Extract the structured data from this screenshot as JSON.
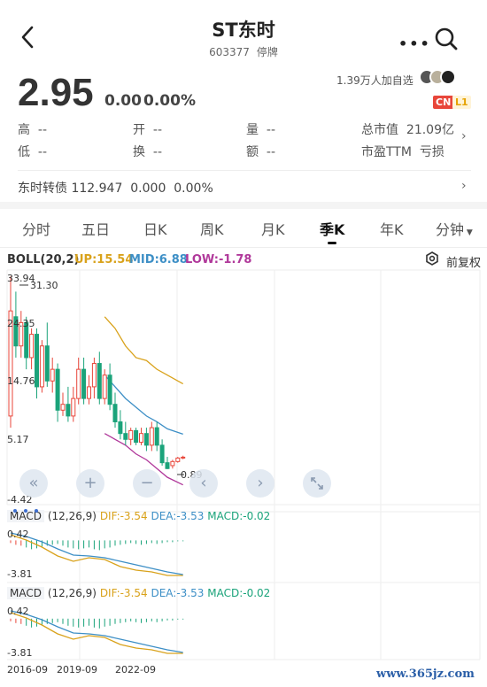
{
  "header": {
    "title": "ST东时",
    "code": "603377",
    "status": "停牌",
    "more_icon": "more-dots-icon",
    "search_icon": "search-icon",
    "back_icon": "back-arrow-icon"
  },
  "quote": {
    "price": "2.95",
    "change": "0.00",
    "change_pct": "0.00%",
    "followers": "1.39万人加自选",
    "badge_cn": "CN",
    "badge_l1": "L1"
  },
  "stats": [
    {
      "label": "高",
      "value": "--"
    },
    {
      "label": "开",
      "value": "--"
    },
    {
      "label": "量",
      "value": "--"
    },
    {
      "label": "总市值",
      "value": "21.09亿"
    },
    {
      "label": "低",
      "value": "--"
    },
    {
      "label": "换",
      "value": "--"
    },
    {
      "label": "额",
      "value": "--"
    },
    {
      "label": "市盈TTM",
      "value": "亏损"
    }
  ],
  "bond": {
    "name": "东时转债",
    "price": "112.947",
    "change": "0.000",
    "pct": "0.00%"
  },
  "tabs": [
    "分时",
    "五日",
    "日K",
    "周K",
    "月K",
    "季K",
    "年K",
    "分钟"
  ],
  "active_tab": "季K",
  "indicators": {
    "boll_name": "BOLL(20,2)",
    "up": "UP:15.54",
    "mid": "MID:6.88",
    "low": "LOW:-1.78",
    "restore_label": "前复权",
    "macd1": {
      "name": "MACD",
      "params": "(12,26,9)",
      "dif": "DIF:-3.54",
      "dea": "DEA:-3.53",
      "macd": "MACD:-0.02",
      "top": "0.42",
      "bottom": "-3.81"
    },
    "macd2": {
      "name": "MACD",
      "params": "(12,26,9)",
      "dif": "DIF:-3.54",
      "dea": "DEA:-3.53",
      "macd": "MACD:-0.02",
      "top": "0.42",
      "bottom": "-3.81"
    }
  },
  "colors": {
    "up": "#e8463a",
    "down": "#1aa37a",
    "boll_up": "#d9a21b",
    "boll_mid": "#3d8fc6",
    "boll_low": "#b0389a",
    "dif": "#d9a21b",
    "dea": "#3d8fc6"
  },
  "chart_data": {
    "type": "candlestick",
    "y_ticks": [
      "33.94",
      "24.35",
      "14.76",
      "5.17",
      "-4.42"
    ],
    "high_marker": "31.30",
    "low_marker": "0.89",
    "x_ticks": [
      "2016-09",
      "2019-09",
      "2022-09"
    ],
    "ylim": [
      -4.42,
      33.94
    ],
    "candles": [
      {
        "o": 10,
        "c": 28,
        "h": 33.9,
        "l": 8
      },
      {
        "o": 27,
        "c": 22,
        "h": 31.3,
        "l": 20
      },
      {
        "o": 22,
        "c": 26,
        "h": 28,
        "l": 20
      },
      {
        "o": 26,
        "c": 20,
        "h": 27,
        "l": 18
      },
      {
        "o": 20,
        "c": 24,
        "h": 25,
        "l": 18
      },
      {
        "o": 24,
        "c": 15,
        "h": 25,
        "l": 13
      },
      {
        "o": 15,
        "c": 22,
        "h": 23,
        "l": 14
      },
      {
        "o": 22,
        "c": 16,
        "h": 26,
        "l": 15
      },
      {
        "o": 16,
        "c": 18,
        "h": 20,
        "l": 14
      },
      {
        "o": 18,
        "c": 11,
        "h": 19,
        "l": 9
      },
      {
        "o": 11,
        "c": 12,
        "h": 14,
        "l": 10
      },
      {
        "o": 12,
        "c": 10,
        "h": 15,
        "l": 9
      },
      {
        "o": 10,
        "c": 13,
        "h": 15,
        "l": 9
      },
      {
        "o": 13,
        "c": 18,
        "h": 20,
        "l": 12
      },
      {
        "o": 18,
        "c": 13,
        "h": 20,
        "l": 12
      },
      {
        "o": 13,
        "c": 15,
        "h": 17,
        "l": 12
      },
      {
        "o": 15,
        "c": 19,
        "h": 20,
        "l": 13
      },
      {
        "o": 19,
        "c": 13,
        "h": 21,
        "l": 12
      },
      {
        "o": 13,
        "c": 17,
        "h": 18,
        "l": 12
      },
      {
        "o": 17,
        "c": 12,
        "h": 19,
        "l": 11
      },
      {
        "o": 12,
        "c": 9,
        "h": 14,
        "l": 8
      },
      {
        "o": 9,
        "c": 7,
        "h": 11,
        "l": 6
      },
      {
        "o": 7,
        "c": 6,
        "h": 9,
        "l": 5
      },
      {
        "o": 6,
        "c": 7.5,
        "h": 8,
        "l": 5
      },
      {
        "o": 7.5,
        "c": 5.5,
        "h": 8,
        "l": 5
      },
      {
        "o": 5.5,
        "c": 7,
        "h": 8,
        "l": 5
      },
      {
        "o": 7,
        "c": 5,
        "h": 8,
        "l": 4
      },
      {
        "o": 5,
        "c": 8,
        "h": 9,
        "l": 4
      },
      {
        "o": 8,
        "c": 5,
        "h": 9,
        "l": 4
      },
      {
        "o": 5,
        "c": 2,
        "h": 6,
        "l": 1.5
      },
      {
        "o": 2,
        "c": 1,
        "h": 3,
        "l": 0.9
      },
      {
        "o": 1.5,
        "c": 2.2,
        "h": 2.5,
        "l": 1
      },
      {
        "o": 2.2,
        "c": 2.8,
        "h": 3,
        "l": 2
      },
      {
        "o": 2.8,
        "c": 2.95,
        "h": 3.2,
        "l": 2.6
      }
    ]
  }
}
